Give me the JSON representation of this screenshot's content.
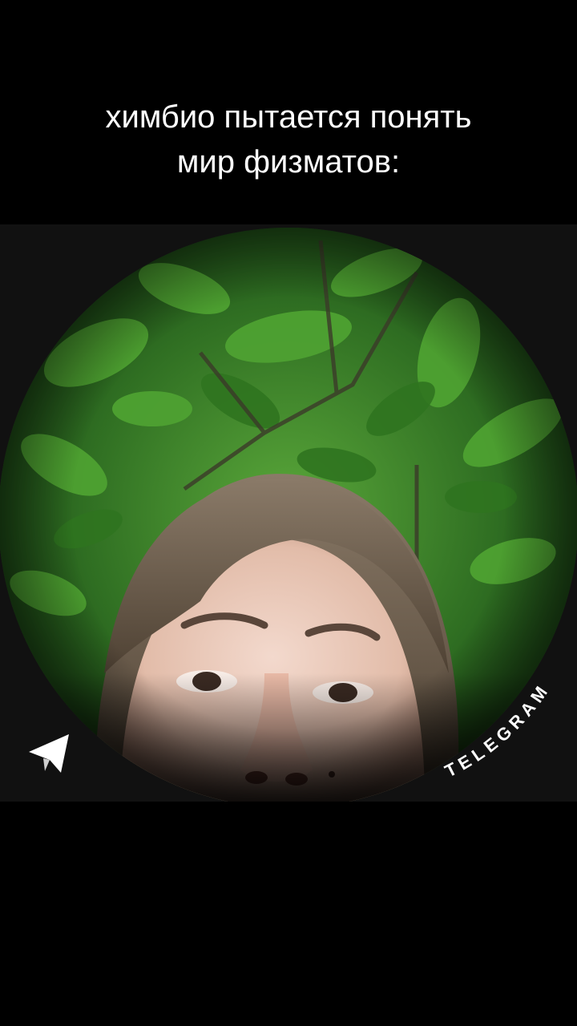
{
  "caption": {
    "line1": "химбио пытается понять",
    "line2": "мир физматов:"
  },
  "video_circle": {
    "brand_label": "TELEGRAM",
    "brand_icon": "telegram-plane-icon",
    "scene": "person"
  },
  "colors": {
    "background": "#000000",
    "foliage": "#3f8f2c",
    "caption_text": "#ffffff"
  }
}
